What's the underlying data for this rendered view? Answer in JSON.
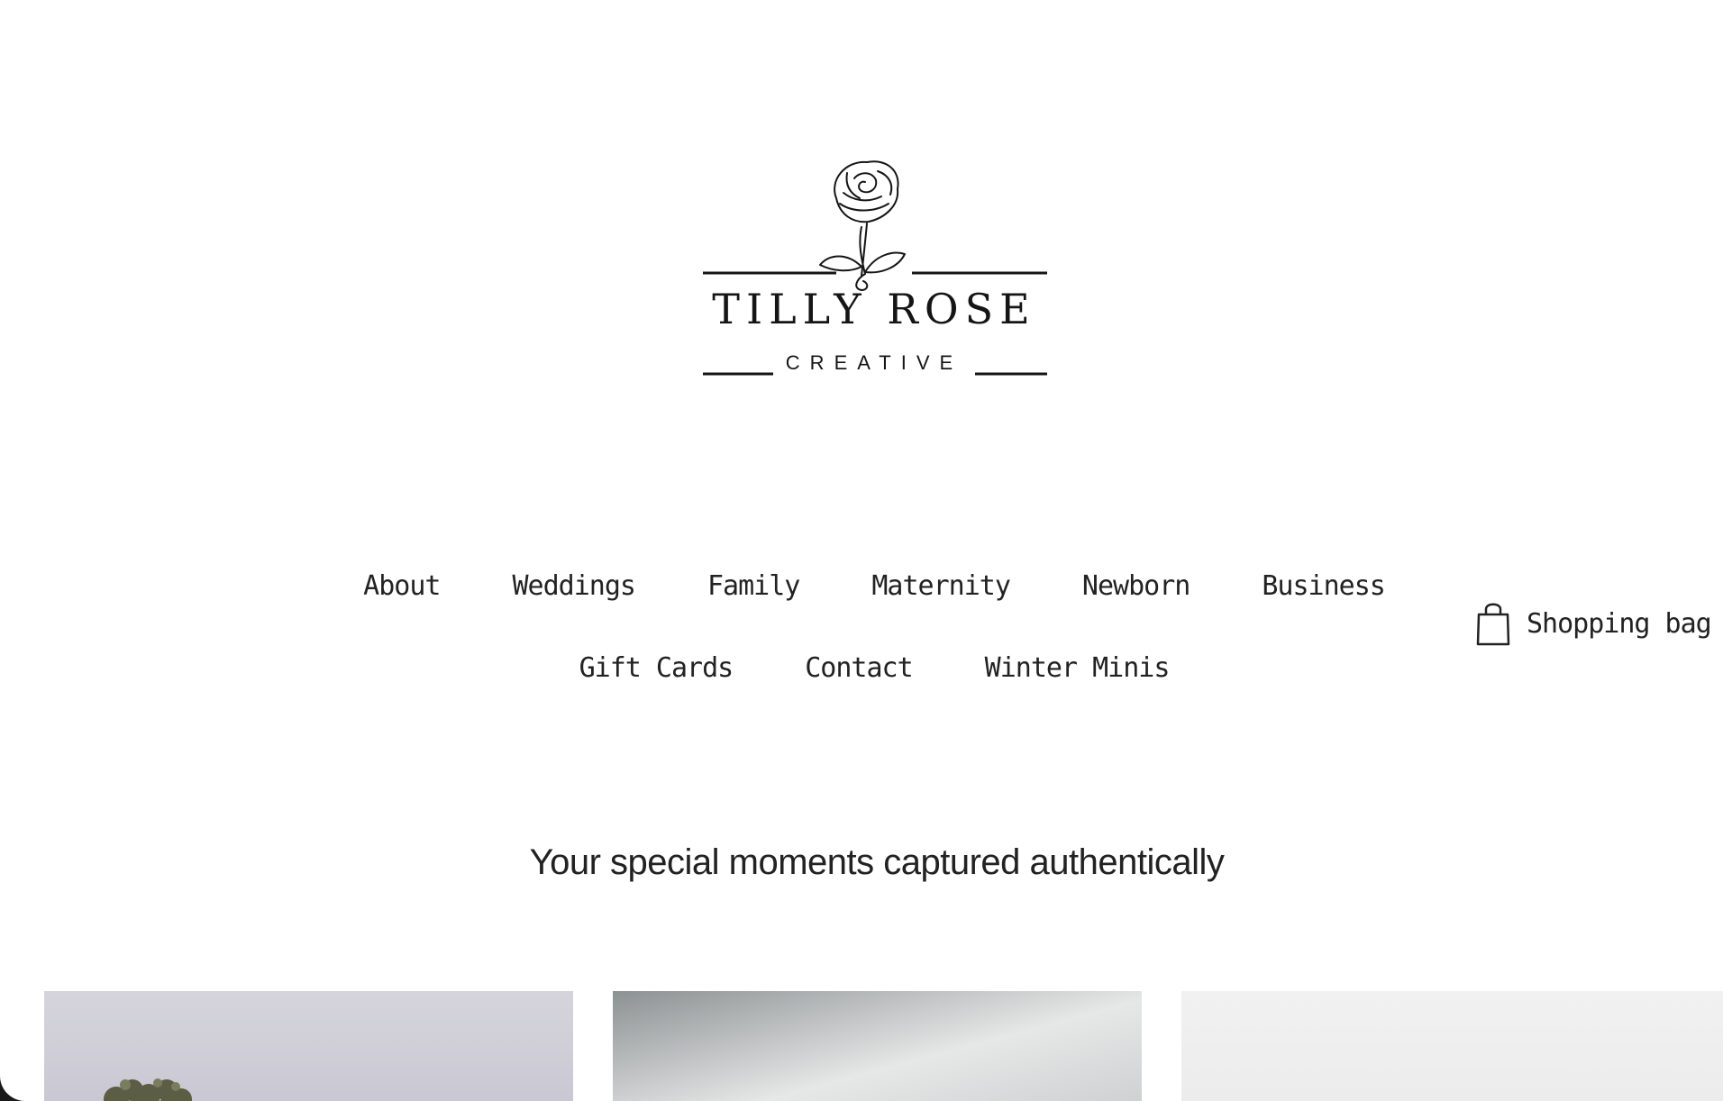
{
  "brand": {
    "title": "TILLY ROSE",
    "subtitle": "CREATIVE",
    "logo_icon": "rose-line-drawing"
  },
  "nav": {
    "row1": [
      "About",
      "Weddings",
      "Family",
      "Maternity",
      "Newborn",
      "Business"
    ],
    "row2": [
      "Gift Cards",
      "Contact",
      "Winter Minis"
    ]
  },
  "cart": {
    "label": "Shopping bag",
    "icon": "shopping-bag-icon"
  },
  "hero": {
    "tagline": "Your special moments captured authentically"
  },
  "colors": {
    "text": "#222222",
    "background": "#ffffff"
  }
}
